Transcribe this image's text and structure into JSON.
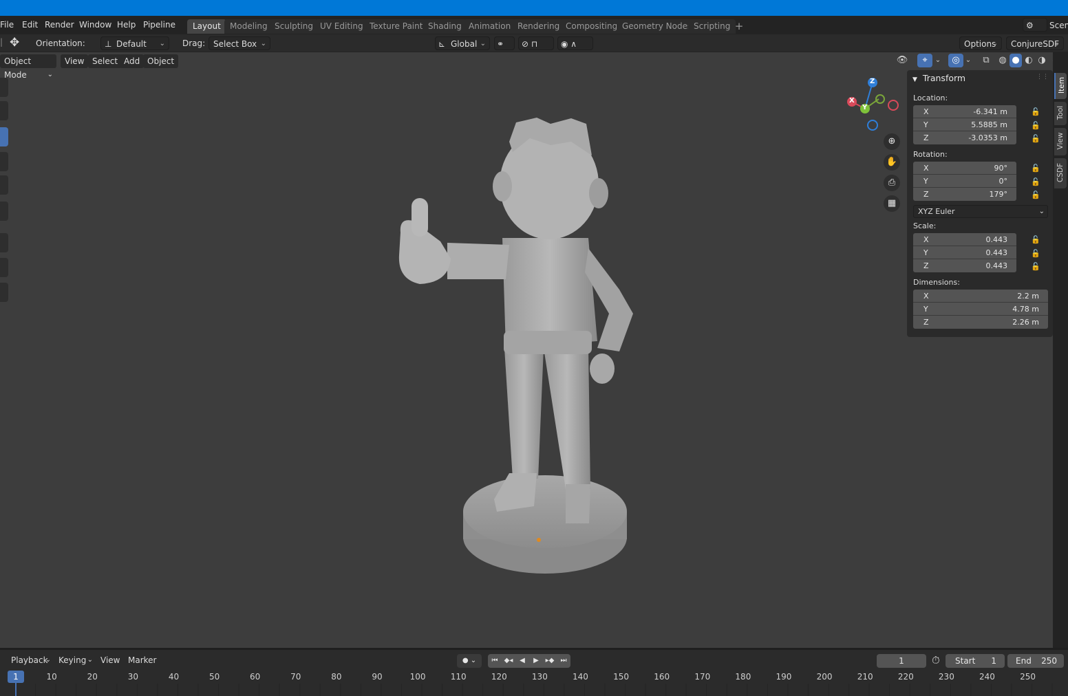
{
  "menu": [
    "File",
    "Edit",
    "Render",
    "Window",
    "Help",
    "Pipeline"
  ],
  "workspaces": [
    {
      "label": "Layout",
      "active": true
    },
    {
      "label": "Modeling"
    },
    {
      "label": "Sculpting"
    },
    {
      "label": "UV Editing"
    },
    {
      "label": "Texture Paint"
    },
    {
      "label": "Shading"
    },
    {
      "label": "Animation"
    },
    {
      "label": "Rendering"
    },
    {
      "label": "Compositing"
    },
    {
      "label": "Geometry Nodes"
    },
    {
      "label": "Scripting"
    }
  ],
  "scene_label": "Scene",
  "toolbar": {
    "orientation_label": "Orientation:",
    "orientation_value": "Default",
    "drag_label": "Drag:",
    "drag_value": "Select Box",
    "transform_orientation": "Global",
    "options": "Options",
    "addon": "ConjureSDF"
  },
  "viewport_header": {
    "mode": "Object Mode",
    "items": [
      "View",
      "Select",
      "Add",
      "Object"
    ]
  },
  "npanel": {
    "title": "Transform",
    "location_label": "Location:",
    "location": [
      {
        "axis": "X",
        "value": "-6.341 m"
      },
      {
        "axis": "Y",
        "value": "5.5885 m"
      },
      {
        "axis": "Z",
        "value": "-3.0353 m"
      }
    ],
    "rotation_label": "Rotation:",
    "rotation": [
      {
        "axis": "X",
        "value": "90°"
      },
      {
        "axis": "Y",
        "value": "0°"
      },
      {
        "axis": "Z",
        "value": "179°"
      }
    ],
    "rotation_mode": "XYZ Euler",
    "scale_label": "Scale:",
    "scale": [
      {
        "axis": "X",
        "value": "0.443"
      },
      {
        "axis": "Y",
        "value": "0.443"
      },
      {
        "axis": "Z",
        "value": "0.443"
      }
    ],
    "dimensions_label": "Dimensions:",
    "dimensions": [
      {
        "axis": "X",
        "value": "2.2 m"
      },
      {
        "axis": "Y",
        "value": "4.78 m"
      },
      {
        "axis": "Z",
        "value": "2.26 m"
      }
    ],
    "tabs": [
      "Item",
      "Tool",
      "View",
      "CSDF"
    ]
  },
  "gizmo": {
    "x": "X",
    "y": "Y",
    "z": "Z"
  },
  "timeline": {
    "menus": [
      "Playback",
      "Keying",
      "View",
      "Marker"
    ],
    "current_frame": "1",
    "start_label": "Start",
    "start_value": "1",
    "end_label": "End",
    "end_value": "250",
    "marker_frame": "1",
    "ruler_ticks": [
      "10",
      "20",
      "30",
      "40",
      "50",
      "60",
      "70",
      "80",
      "90",
      "100",
      "110",
      "120",
      "130",
      "140",
      "150",
      "160",
      "170",
      "180",
      "190",
      "200",
      "210",
      "220",
      "230",
      "240",
      "250"
    ]
  }
}
